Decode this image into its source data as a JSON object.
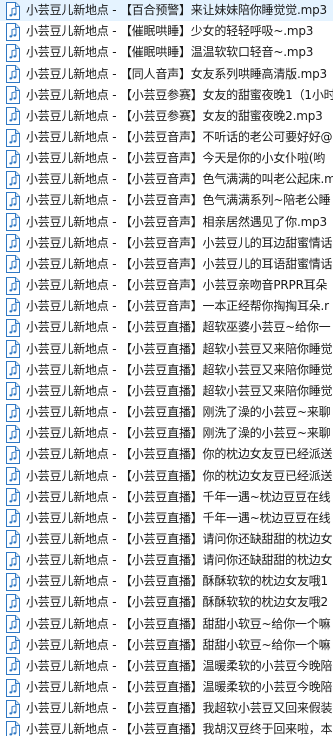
{
  "files": [
    {
      "name": "小芸豆儿新地点 - 【百合预警】来让妹妹陪你睡觉觉.mp3",
      "icon": "audio-file-icon"
    },
    {
      "name": "小芸豆儿新地点 - 【催眠哄睡】少女的轻轻呼吸~.mp3",
      "icon": "audio-file-icon"
    },
    {
      "name": "小芸豆儿新地点 - 【催眠哄睡】温温软软口轻音~.mp3",
      "icon": "audio-file-icon"
    },
    {
      "name": "小芸豆儿新地点 - 【同人音声】女友系列哄睡高清版.mp3",
      "icon": "audio-file-icon"
    },
    {
      "name": "小芸豆儿新地点 - 【小芸豆参赛】女友的甜蜜夜晚1（1小时",
      "icon": "audio-file-icon"
    },
    {
      "name": "小芸豆儿新地点 - 【小芸豆参赛】女友的甜蜜夜晚2.mp3",
      "icon": "audio-file-icon"
    },
    {
      "name": "小芸豆儿新地点 - 【小芸豆音声】不听话的老公可要好好@",
      "icon": "audio-file-icon"
    },
    {
      "name": "小芸豆儿新地点 - 【小芸豆音声】今天是你的小女仆啦(哟",
      "icon": "audio-file-icon"
    },
    {
      "name": "小芸豆儿新地点 - 【小芸豆音声】色气满满的叫老公起床.m",
      "icon": "audio-file-icon"
    },
    {
      "name": "小芸豆儿新地点 - 【小芸豆音声】色气满满系列~陪老公睡",
      "icon": "audio-file-icon"
    },
    {
      "name": "小芸豆儿新地点 - 【小芸豆音声】相亲居然遇见了你.mp3",
      "icon": "audio-file-icon"
    },
    {
      "name": "小芸豆儿新地点 - 【小芸豆音声】小芸豆儿的耳边甜蜜情话",
      "icon": "audio-file-icon"
    },
    {
      "name": "小芸豆儿新地点 - 【小芸豆音声】小芸豆儿的耳语甜蜜情话",
      "icon": "audio-file-icon"
    },
    {
      "name": "小芸豆儿新地点 - 【小芸豆音声】小芸豆亲吻音PRPR耳朵",
      "icon": "audio-file-icon"
    },
    {
      "name": "小芸豆儿新地点 - 【小芸豆音声】一本正经帮你掏掏耳朵.r",
      "icon": "audio-file-icon"
    },
    {
      "name": "小芸豆儿新地点 - 【小芸豆直播】超软巫婆小芸豆~给你一",
      "icon": "audio-file-icon"
    },
    {
      "name": "小芸豆儿新地点 - 【小芸豆直播】超软小芸豆又来陪你睡觉",
      "icon": "audio-file-icon"
    },
    {
      "name": "小芸豆儿新地点 - 【小芸豆直播】超软小芸豆又来陪你睡觉",
      "icon": "audio-file-icon"
    },
    {
      "name": "小芸豆儿新地点 - 【小芸豆直播】超软小芸豆又来陪你睡觉",
      "icon": "audio-file-icon"
    },
    {
      "name": "小芸豆儿新地点 - 【小芸豆直播】刚洗了澡的小芸豆~来聊",
      "icon": "audio-file-icon"
    },
    {
      "name": "小芸豆儿新地点 - 【小芸豆直播】刚洗了澡的小芸豆~来聊",
      "icon": "audio-file-icon"
    },
    {
      "name": "小芸豆儿新地点 - 【小芸豆直播】你的枕边女友豆已经派送",
      "icon": "audio-file-icon"
    },
    {
      "name": "小芸豆儿新地点 - 【小芸豆直播】你的枕边女友豆已经派送",
      "icon": "audio-file-icon"
    },
    {
      "name": "小芸豆儿新地点 - 【小芸豆直播】千年一遇~枕边豆豆在线",
      "icon": "audio-file-icon"
    },
    {
      "name": "小芸豆儿新地点 - 【小芸豆直播】千年一遇~枕边豆豆在线",
      "icon": "audio-file-icon"
    },
    {
      "name": "小芸豆儿新地点 - 【小芸豆直播】请问你还缺甜甜的枕边女",
      "icon": "audio-file-icon"
    },
    {
      "name": "小芸豆儿新地点 - 【小芸豆直播】请问你还缺甜甜的枕边女",
      "icon": "audio-file-icon"
    },
    {
      "name": "小芸豆儿新地点 - 【小芸豆直播】酥酥软软的枕边女友哦1",
      "icon": "audio-file-icon"
    },
    {
      "name": "小芸豆儿新地点 - 【小芸豆直播】酥酥软软的枕边女友哦2",
      "icon": "audio-file-icon"
    },
    {
      "name": "小芸豆儿新地点 - 【小芸豆直播】甜甜小软豆~给你一个嘛",
      "icon": "audio-file-icon"
    },
    {
      "name": "小芸豆儿新地点 - 【小芸豆直播】甜甜小软豆~给你一个嘛",
      "icon": "audio-file-icon"
    },
    {
      "name": "小芸豆儿新地点 - 【小芸豆直播】温暖柔软的小芸豆今晚陪",
      "icon": "audio-file-icon"
    },
    {
      "name": "小芸豆儿新地点 - 【小芸豆直播】温暖柔软的小芸豆今晚陪",
      "icon": "audio-file-icon"
    },
    {
      "name": "小芸豆儿新地点 - 【小芸豆直播】我超软小芸豆又回来假装",
      "icon": "audio-file-icon"
    },
    {
      "name": "小芸豆儿新地点 - 【小芸豆直播】我胡汉豆终于回来啦，本",
      "icon": "audio-file-icon"
    }
  ]
}
